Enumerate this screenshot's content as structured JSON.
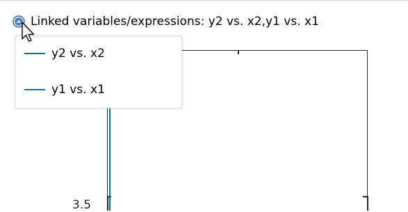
{
  "header": {
    "text": "Linked variables/expressions: y2 vs. x2,y1 vs. x1"
  },
  "legend": {
    "items": [
      {
        "label": "y2 vs. x2",
        "color": "#0072bd"
      },
      {
        "label": "y1 vs. x1",
        "color": "#0072bd"
      }
    ]
  },
  "axes": {
    "ytick_labels": [
      "3.5"
    ]
  },
  "icons": {
    "collapse": "chevron-up-circle-icon",
    "cursor": "mouse-pointer-icon"
  },
  "colors": {
    "accent": "#0072bd",
    "axis": "#262626"
  }
}
